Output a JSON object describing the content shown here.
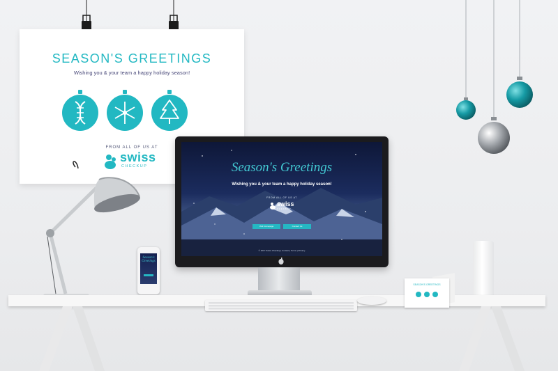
{
  "poster": {
    "title": "SEASON'S GREETINGS",
    "subtitle": "Wishing you & your team a happy holiday season!",
    "from": "FROM ALL OF US AT",
    "brand": "swiss",
    "brand_sub": "CHECKUP",
    "ornaments": [
      "dna-icon",
      "snowflake-icon",
      "tree-icon"
    ]
  },
  "screen": {
    "title": "Season's Greetings",
    "subtitle": "Wishing you & your team a happy holiday season!",
    "from": "FROM ALL OF US AT",
    "brand": "swiss",
    "brand_sub": "CHECKUP",
    "button_1": "Visit homepage",
    "button_2": "Contact Us",
    "footer": "© 2017 Swiss Checkup | Contact | Terms | Privacy"
  },
  "phone": {
    "title": "Season's Greetings"
  },
  "card": {
    "title": "SEASON'S GREETINGS"
  },
  "colors": {
    "accent": "#22b8c2",
    "screen_bg": "#1b2c5e",
    "subtitle_text": "#4a4a7a"
  }
}
